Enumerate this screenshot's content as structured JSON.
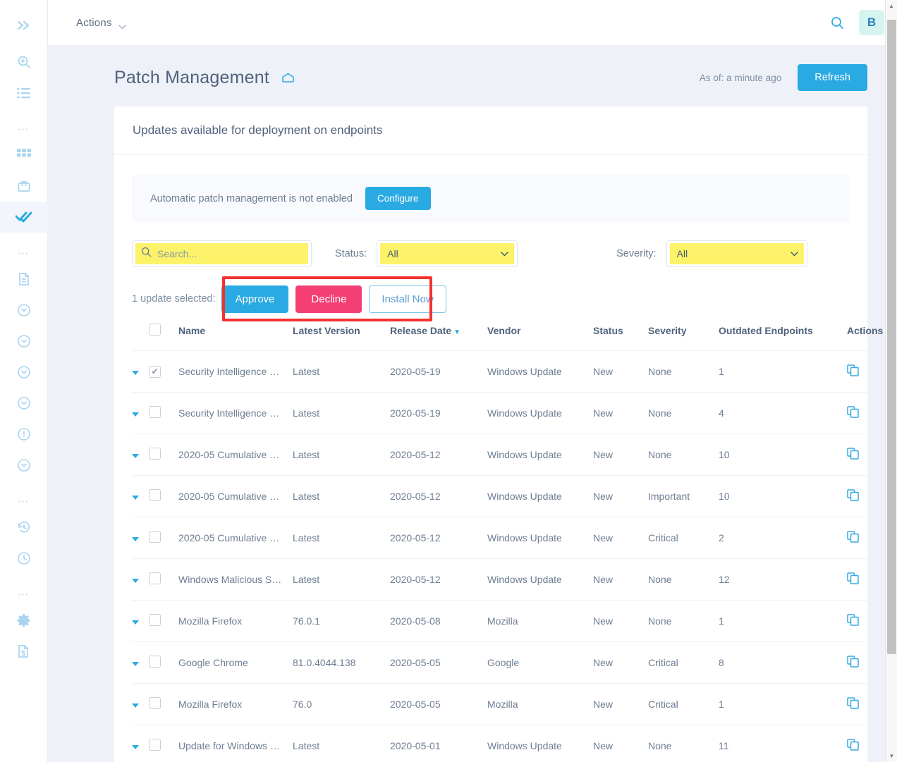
{
  "sidebar": {
    "items": [
      {
        "name": "expand-collapse-icon",
        "label": "Expand"
      },
      {
        "name": "search-zoom-icon",
        "label": "Search"
      },
      {
        "name": "list-icon",
        "label": "List"
      },
      {
        "name": "grid-icon",
        "label": "Dashboard"
      },
      {
        "name": "briefcase-icon",
        "label": "Assets"
      },
      {
        "name": "double-check-icon",
        "label": "Patch Management"
      },
      {
        "name": "document-icon",
        "label": "Reports"
      },
      {
        "name": "circle-arrow-icon-1",
        "label": "Item"
      },
      {
        "name": "circle-arrow-icon-2",
        "label": "Item"
      },
      {
        "name": "circle-arrow-icon-3",
        "label": "Item"
      },
      {
        "name": "circle-arrow-icon-4",
        "label": "Item"
      },
      {
        "name": "circle-alert-icon",
        "label": "Alerts"
      },
      {
        "name": "circle-arrow-icon-5",
        "label": "Item"
      },
      {
        "name": "history-icon",
        "label": "History"
      },
      {
        "name": "clock-icon",
        "label": "Scheduled"
      },
      {
        "name": "gear-icon",
        "label": "Settings"
      },
      {
        "name": "billing-icon",
        "label": "Billing"
      }
    ],
    "separator": "⋯"
  },
  "topbar": {
    "actions_label": "Actions",
    "search_icon": "search-icon",
    "avatar_initial": "B"
  },
  "header": {
    "title": "Patch Management",
    "home_icon": "home-icon",
    "as_of": "As of: a minute ago",
    "refresh_label": "Refresh"
  },
  "card": {
    "title": "Updates available for deployment on endpoints"
  },
  "notice": {
    "text": "Automatic patch management is not enabled",
    "configure_label": "Configure"
  },
  "filters": {
    "search_placeholder": "Search...",
    "search_value": "",
    "status_label": "Status:",
    "status_value": "All",
    "status_options": [
      "All"
    ],
    "severity_label": "Severity:",
    "severity_value": "All",
    "severity_options": [
      "All"
    ]
  },
  "selection": {
    "count_text": "1 update selected:",
    "approve_label": "Approve",
    "decline_label": "Decline",
    "install_label": "Install Now"
  },
  "table": {
    "columns": [
      "Name",
      "Latest Version",
      "Release Date",
      "Vendor",
      "Status",
      "Severity",
      "Outdated Endpoints",
      "Actions"
    ],
    "sorted_column": "Release Date",
    "sort_direction": "desc",
    "rows": [
      {
        "checked": true,
        "name": "Security Intelligence …",
        "version": "Latest",
        "date": "2020-05-19",
        "vendor": "Windows Update",
        "status": "New",
        "severity": "None",
        "endpoints": "1"
      },
      {
        "checked": false,
        "name": "Security Intelligence …",
        "version": "Latest",
        "date": "2020-05-19",
        "vendor": "Windows Update",
        "status": "New",
        "severity": "None",
        "endpoints": "4"
      },
      {
        "checked": false,
        "name": "2020-05 Cumulative …",
        "version": "Latest",
        "date": "2020-05-12",
        "vendor": "Windows Update",
        "status": "New",
        "severity": "None",
        "endpoints": "10"
      },
      {
        "checked": false,
        "name": "2020-05 Cumulative …",
        "version": "Latest",
        "date": "2020-05-12",
        "vendor": "Windows Update",
        "status": "New",
        "severity": "Important",
        "endpoints": "10"
      },
      {
        "checked": false,
        "name": "2020-05 Cumulative …",
        "version": "Latest",
        "date": "2020-05-12",
        "vendor": "Windows Update",
        "status": "New",
        "severity": "Critical",
        "endpoints": "2"
      },
      {
        "checked": false,
        "name": "Windows Malicious S…",
        "version": "Latest",
        "date": "2020-05-12",
        "vendor": "Windows Update",
        "status": "New",
        "severity": "None",
        "endpoints": "12"
      },
      {
        "checked": false,
        "name": "Mozilla Firefox",
        "version": "76.0.1",
        "date": "2020-05-08",
        "vendor": "Mozilla",
        "status": "New",
        "severity": "None",
        "endpoints": "1"
      },
      {
        "checked": false,
        "name": "Google Chrome",
        "version": "81.0.4044.138",
        "date": "2020-05-05",
        "vendor": "Google",
        "status": "New",
        "severity": "Critical",
        "endpoints": "8"
      },
      {
        "checked": false,
        "name": "Mozilla Firefox",
        "version": "76.0",
        "date": "2020-05-05",
        "vendor": "Mozilla",
        "status": "New",
        "severity": "Critical",
        "endpoints": "1"
      },
      {
        "checked": false,
        "name": "Update for Windows …",
        "version": "Latest",
        "date": "2020-05-01",
        "vendor": "Windows Update",
        "status": "New",
        "severity": "None",
        "endpoints": "11"
      }
    ],
    "row_action_icon": "copy-icon"
  },
  "colors": {
    "accent_blue": "#29aae3",
    "decline_pink": "#f43f75",
    "highlight_yellow": "#fcf36a",
    "annotation_red": "#f4312f",
    "avatar_bg": "#d5f4f0"
  }
}
